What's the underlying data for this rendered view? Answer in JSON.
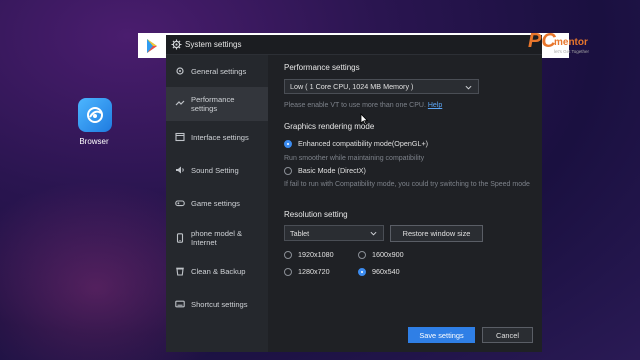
{
  "desktop": {
    "icon_label": "Browser",
    "icon_name": "browser-icon"
  },
  "window": {
    "title": "System settings",
    "icon": "gear-icon"
  },
  "sidebar": {
    "items": [
      {
        "label": "General settings",
        "icon": "general-settings-icon",
        "active": false
      },
      {
        "label": "Performance settings",
        "icon": "performance-icon",
        "active": true
      },
      {
        "label": "Interface settings",
        "icon": "interface-icon",
        "active": false
      },
      {
        "label": "Sound Setting",
        "icon": "sound-icon",
        "active": false
      },
      {
        "label": "Game settings",
        "icon": "gamepad-icon",
        "active": false
      },
      {
        "label": "phone model & Internet",
        "icon": "phone-icon",
        "active": false
      },
      {
        "label": "Clean & Backup",
        "icon": "trash-icon",
        "active": false
      },
      {
        "label": "Shortcut settings",
        "icon": "keyboard-icon",
        "active": false
      }
    ]
  },
  "performance": {
    "heading": "Performance settings",
    "selected": "Low ( 1 Core CPU, 1024 MB Memory )",
    "note": "Please enable VT to use more than one CPU.",
    "help_link": "Help"
  },
  "graphics": {
    "heading": "Graphics rendering mode",
    "option1": {
      "label": "Enhanced compatibility mode(OpenGL+)",
      "selected": true
    },
    "option1_note": "Run smoother while maintaining compatibility",
    "option2": {
      "label": "Basic Mode (DirectX)",
      "selected": false
    },
    "option2_note": "If fail to run with Compatibility mode, you could try switching to the Speed mode"
  },
  "resolution": {
    "heading": "Resolution setting",
    "selected": "Tablet",
    "restore_label": "Restore window size",
    "options": [
      {
        "label": "1920x1080",
        "selected": false
      },
      {
        "label": "1600x900",
        "selected": false
      },
      {
        "label": "1280x720",
        "selected": false
      },
      {
        "label": "960x540",
        "selected": true
      }
    ]
  },
  "footer": {
    "save_label": "Save settings",
    "cancel_label": "Cancel"
  },
  "watermark": {
    "logo_pc": "PC",
    "logo_text": "mentor",
    "tagline": "let's Get Together"
  },
  "colors": {
    "accent": "#2f7fe6",
    "panel": "#1f2125",
    "sidebar": "#25282d",
    "brand": "#e8762c"
  }
}
